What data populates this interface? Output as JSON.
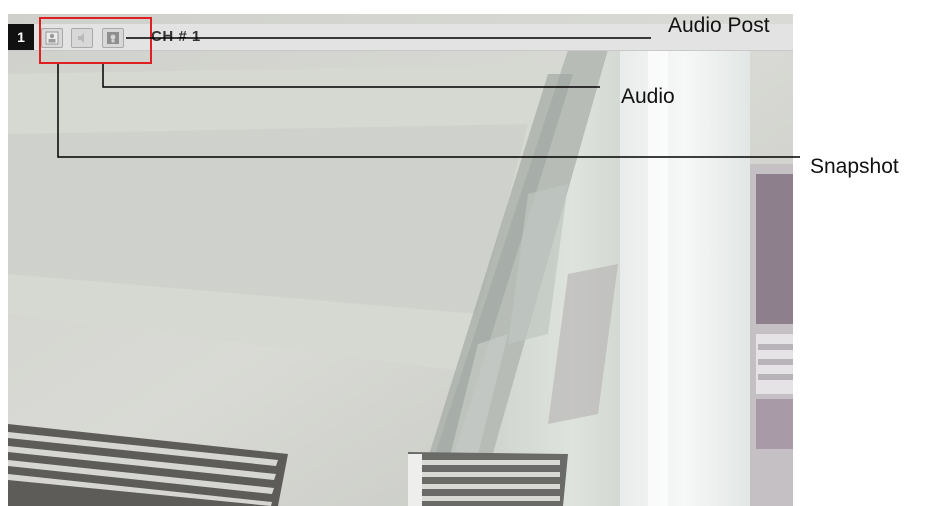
{
  "camera": {
    "channel_number": "1",
    "channel_label": "CH # 1",
    "toolbar_icons": [
      "snapshot-icon",
      "audio-icon",
      "audio-post-icon"
    ]
  },
  "callouts": {
    "audio_post": "Audio Post",
    "audio": "Audio",
    "snapshot": "Snapshot"
  },
  "colors": {
    "highlight": "#e02020",
    "toolbar": "#e3e3e3",
    "channel_badge": "#111111"
  }
}
